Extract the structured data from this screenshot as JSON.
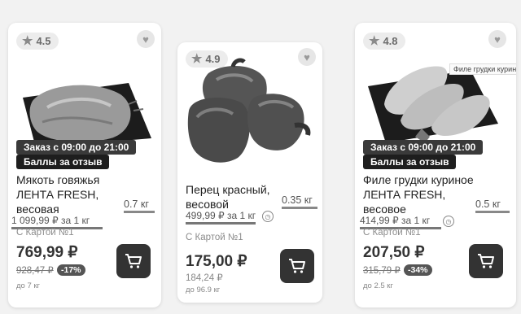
{
  "products": [
    {
      "rating": "4.5",
      "delivery_badge": "Заказ с 09:00 до 21:00",
      "points_badge": "Баллы за отзыв",
      "name": [
        "Мякоть говяжья",
        "ЛЕНТА FRESH,",
        "весовая"
      ],
      "weight": "0.7 кг",
      "unit_price": "1 099,99 ₽ за 1 кг",
      "card_label": "С Картой №1",
      "price": "769,99 ₽",
      "old_price": "928,47 ₽",
      "discount": "-17%",
      "limit": "до 7 кг",
      "icon": "cart-icon"
    },
    {
      "rating": "4.9",
      "name": [
        "Перец красный,",
        "весовой"
      ],
      "weight": "0.35 кг",
      "unit_price": "499,99 ₽ за 1 кг",
      "card_label": "С Картой №1",
      "price": "175,00 ₽",
      "old_price": "184,24 ₽",
      "limit": "до 96.9 кг",
      "icon": "cart-icon"
    },
    {
      "rating": "4.8",
      "tooltip": "Филе грудки куриное",
      "delivery_badge": "Заказ с 09:00 до 21:00",
      "points_badge": "Баллы за отзыв",
      "name": [
        "Филе грудки куриное",
        "ЛЕНТА FRESH,",
        "весовое"
      ],
      "weight": "0.5 кг",
      "unit_price": "414,99 ₽ за 1 кг",
      "card_label": "С Картой №1",
      "price": "207,50 ₽",
      "old_price": "315,79 ₽",
      "discount": "-34%",
      "limit": "до 2.5 кг",
      "icon": "cart-icon"
    }
  ]
}
